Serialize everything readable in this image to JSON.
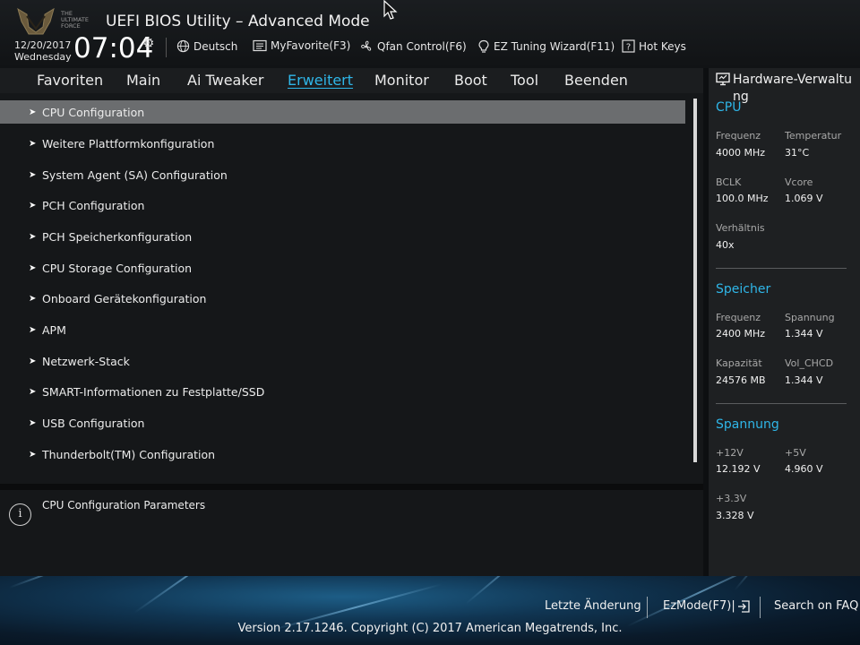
{
  "header": {
    "app_title": "UEFI BIOS Utility – Advanced Mode",
    "logo_text": "THE ULTIMATE FORCE",
    "date": "12/20/2017",
    "weekday": "Wednesday",
    "time": "07:04",
    "toolbar": [
      {
        "icon": "globe-icon",
        "label": "Deutsch"
      },
      {
        "icon": "favorite-icon",
        "label": "MyFavorite(F3)"
      },
      {
        "icon": "fan-icon",
        "label": "Qfan Control(F6)"
      },
      {
        "icon": "bulb-icon",
        "label": "EZ Tuning Wizard(F11)"
      },
      {
        "icon": "help-icon",
        "label": "Hot Keys"
      }
    ]
  },
  "nav": {
    "tabs": [
      {
        "label": "Favoriten"
      },
      {
        "label": "Main"
      },
      {
        "label": "Ai Tweaker"
      },
      {
        "label": "Erweitert"
      },
      {
        "label": "Monitor"
      },
      {
        "label": "Boot"
      },
      {
        "label": "Tool"
      },
      {
        "label": "Beenden"
      }
    ],
    "active": "Erweitert"
  },
  "menu": {
    "items": [
      {
        "label": "CPU Configuration"
      },
      {
        "label": "Weitere Plattformkonfiguration"
      },
      {
        "label": "System Agent (SA) Configuration"
      },
      {
        "label": "PCH Configuration"
      },
      {
        "label": "PCH Speicherkonfiguration"
      },
      {
        "label": "CPU Storage Configuration"
      },
      {
        "label": "Onboard Gerätekonfiguration"
      },
      {
        "label": "APM"
      },
      {
        "label": "Netzwerk-Stack"
      },
      {
        "label": "SMART-Informationen zu Festplatte/SSD"
      },
      {
        "label": "USB Configuration"
      },
      {
        "label": "Thunderbolt(TM) Configuration"
      }
    ],
    "selected": "CPU Configuration"
  },
  "help": {
    "text": "CPU Configuration Parameters"
  },
  "hardware": {
    "title": "Hardware-Verwaltung",
    "cpu": {
      "heading": "CPU",
      "frequency_label": "Frequenz",
      "frequency_value": "4000 MHz",
      "temperature_label": "Temperatur",
      "temperature_value": "31°C",
      "bclk_label": "BCLK",
      "bclk_value": "100.0 MHz",
      "vcore_label": "Vcore",
      "vcore_value": "1.069 V",
      "ratio_label": "Verhältnis",
      "ratio_value": "40x"
    },
    "memory": {
      "heading": "Speicher",
      "frequency_label": "Frequenz",
      "frequency_value": "2400 MHz",
      "voltage_label": "Spannung",
      "voltage_value": "1.344 V",
      "capacity_label": "Kapazität",
      "capacity_value": "24576 MB",
      "volchcd_label": "Vol_CHCD",
      "volchcd_value": "1.344 V"
    },
    "voltage": {
      "heading": "Spannung",
      "v12_label": "+12V",
      "v12_value": "12.192 V",
      "v5_label": "+5V",
      "v5_value": "4.960 V",
      "v33_label": "+3.3V",
      "v33_value": "3.328 V"
    }
  },
  "footer": {
    "last_change": "Letzte Änderung",
    "ezmode": "EzMode(F7)|",
    "faq": "Search on FAQ",
    "version": "Version 2.17.1246. Copyright (C) 2017 American Megatrends, Inc."
  },
  "colors": {
    "accent": "#2fb6e8",
    "selected_row": "#6b6d6f",
    "panel_bg": "#151719"
  }
}
